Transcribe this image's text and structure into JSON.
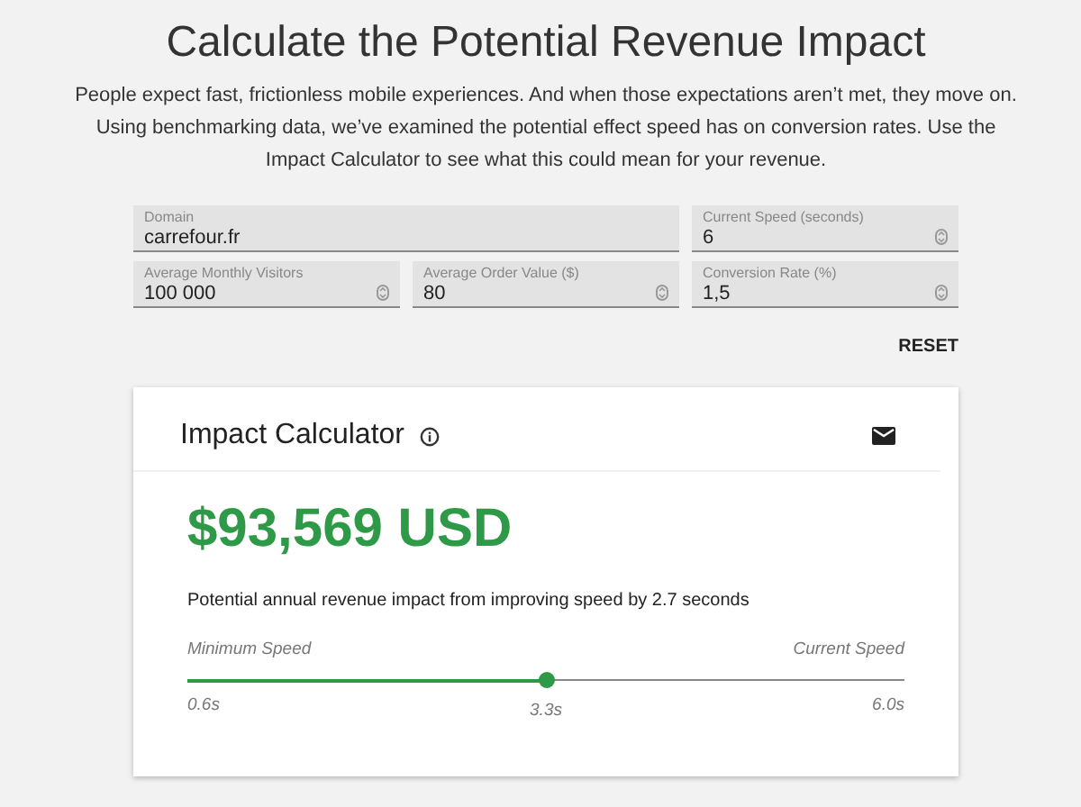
{
  "heading": "Calculate the Potential Revenue Impact",
  "intro": "People expect fast, frictionless mobile experiences. And when those expectations aren’t met, they move on. Using benchmarking data, we’ve examined the potential effect speed has on conversion rates. Use the Impact Calculator to see what this could mean for your revenue.",
  "fields": [
    {
      "label": "Domain",
      "value": "carrefour.fr",
      "kind": "text"
    },
    {
      "label": "Current Speed (seconds)",
      "value": "6",
      "kind": "number"
    },
    {
      "label": "Average Monthly Visitors",
      "value": "100 000",
      "kind": "number"
    },
    {
      "label": "Average Order Value ($)",
      "value": "80",
      "kind": "number"
    },
    {
      "label": "Conversion Rate (%)",
      "value": "1,5",
      "kind": "number"
    }
  ],
  "reset_button": "RESET",
  "card": {
    "title": "Impact Calculator",
    "amount": "$93,569 USD",
    "description": "Potential annual revenue impact from improving speed by 2.7 seconds",
    "slider": {
      "min_label": "Minimum Speed",
      "max_label": "Current Speed",
      "level": 0.5,
      "min_value": "0.6s",
      "current_value": "3.3s",
      "max_value": "6.0s"
    }
  }
}
